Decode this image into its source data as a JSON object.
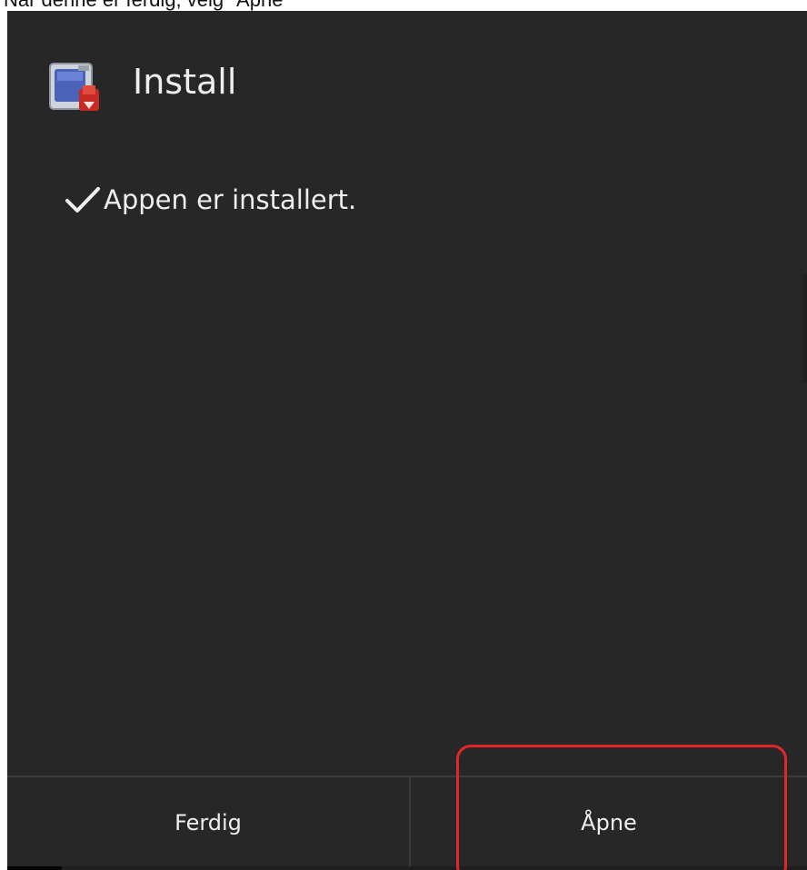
{
  "instruction": {
    "text": "Når denne er ferdig, velg \"Åpne\""
  },
  "dialog": {
    "title": "Install",
    "app_icon": "sd-card-app-icon",
    "status_icon": "checkmark-icon",
    "status_text": "Appen er installert."
  },
  "buttons": {
    "done_label": "Ferdig",
    "open_label": "Åpne"
  },
  "annotation": {
    "highlight_color": "#e3262a",
    "target": "open-button"
  },
  "colors": {
    "background": "#272727",
    "text": "#eeeeee",
    "divider": "#3a3a3a"
  }
}
